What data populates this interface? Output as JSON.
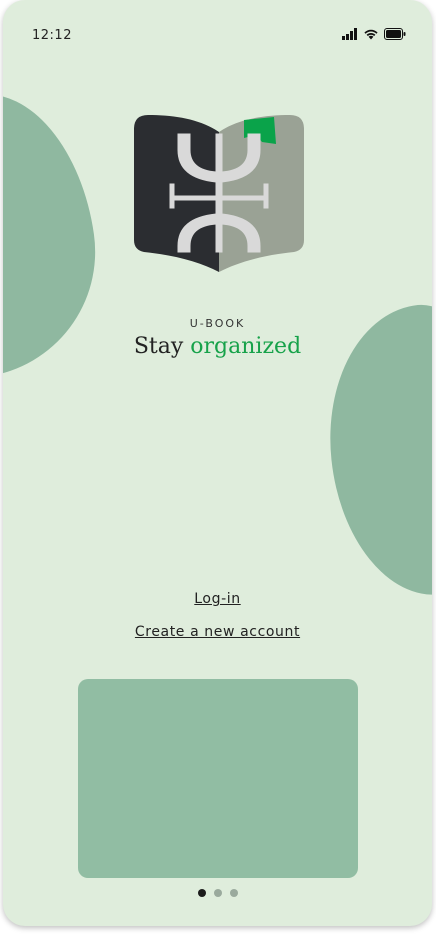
{
  "status_bar": {
    "time": "12:12",
    "icons": [
      "signal-icon",
      "wifi-icon",
      "battery-icon"
    ]
  },
  "brand": {
    "name": "U-BOOK",
    "tagline_prefix": "Stay ",
    "tagline_accent": "organized"
  },
  "actions": {
    "login_label": "Log-in",
    "create_account_label": "Create a new account"
  },
  "carousel": {
    "page_count": 3,
    "active_index": 0
  },
  "colors": {
    "background": "#dfeddc",
    "blob": "#8fb8a0",
    "accent": "#17a24a",
    "card": "#91bda3"
  }
}
